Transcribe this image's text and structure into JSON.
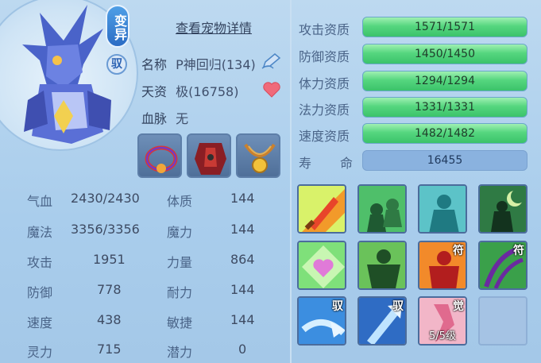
{
  "header": {
    "mutant_badge": "变异",
    "tame_badge": "驭",
    "details_link": "查看宠物详情"
  },
  "info": {
    "name_label": "名称",
    "name_value": "P神回归(134)",
    "talent_label": "天资",
    "talent_value": "极(16758)",
    "bloodline_label": "血脉",
    "bloodline_value": "无"
  },
  "equipment": [
    {
      "name": "collar-equipment"
    },
    {
      "name": "armor-equipment"
    },
    {
      "name": "necklace-equipment"
    }
  ],
  "stats": {
    "hp": {
      "label": "气血",
      "value": "2430/2430"
    },
    "constitution": {
      "label": "体质",
      "value": "144"
    },
    "mp": {
      "label": "魔法",
      "value": "3356/3356"
    },
    "magic_power": {
      "label": "魔力",
      "value": "144"
    },
    "attack": {
      "label": "攻击",
      "value": "1951"
    },
    "strength": {
      "label": "力量",
      "value": "864"
    },
    "defense": {
      "label": "防御",
      "value": "778"
    },
    "endurance": {
      "label": "耐力",
      "value": "144"
    },
    "speed": {
      "label": "速度",
      "value": "438"
    },
    "agility": {
      "label": "敏捷",
      "value": "144"
    },
    "spirit": {
      "label": "灵力",
      "value": "715"
    },
    "potential": {
      "label": "潜力",
      "value": "0"
    }
  },
  "aptitudes": [
    {
      "label": "攻击资质",
      "value": "1571/1571",
      "fill": 1.0
    },
    {
      "label": "防御资质",
      "value": "1450/1450",
      "fill": 1.0
    },
    {
      "label": "体力资质",
      "value": "1294/1294",
      "fill": 1.0
    },
    {
      "label": "法力资质",
      "value": "1331/1331",
      "fill": 1.0
    },
    {
      "label": "速度资质",
      "value": "1482/1482",
      "fill": 1.0
    }
  ],
  "lifespan": {
    "label_a": "寿",
    "label_b": "命",
    "value": "16455"
  },
  "skills": {
    "tag_talisman": "符",
    "tag_tame": "驭",
    "tag_awaken": "觉",
    "awaken_level": "5/5级"
  },
  "colors": {
    "aptitude_bar": "#55d67f",
    "lifespan_bar": "#8ab2df",
    "mutant_badge": "#2b6cc4"
  }
}
